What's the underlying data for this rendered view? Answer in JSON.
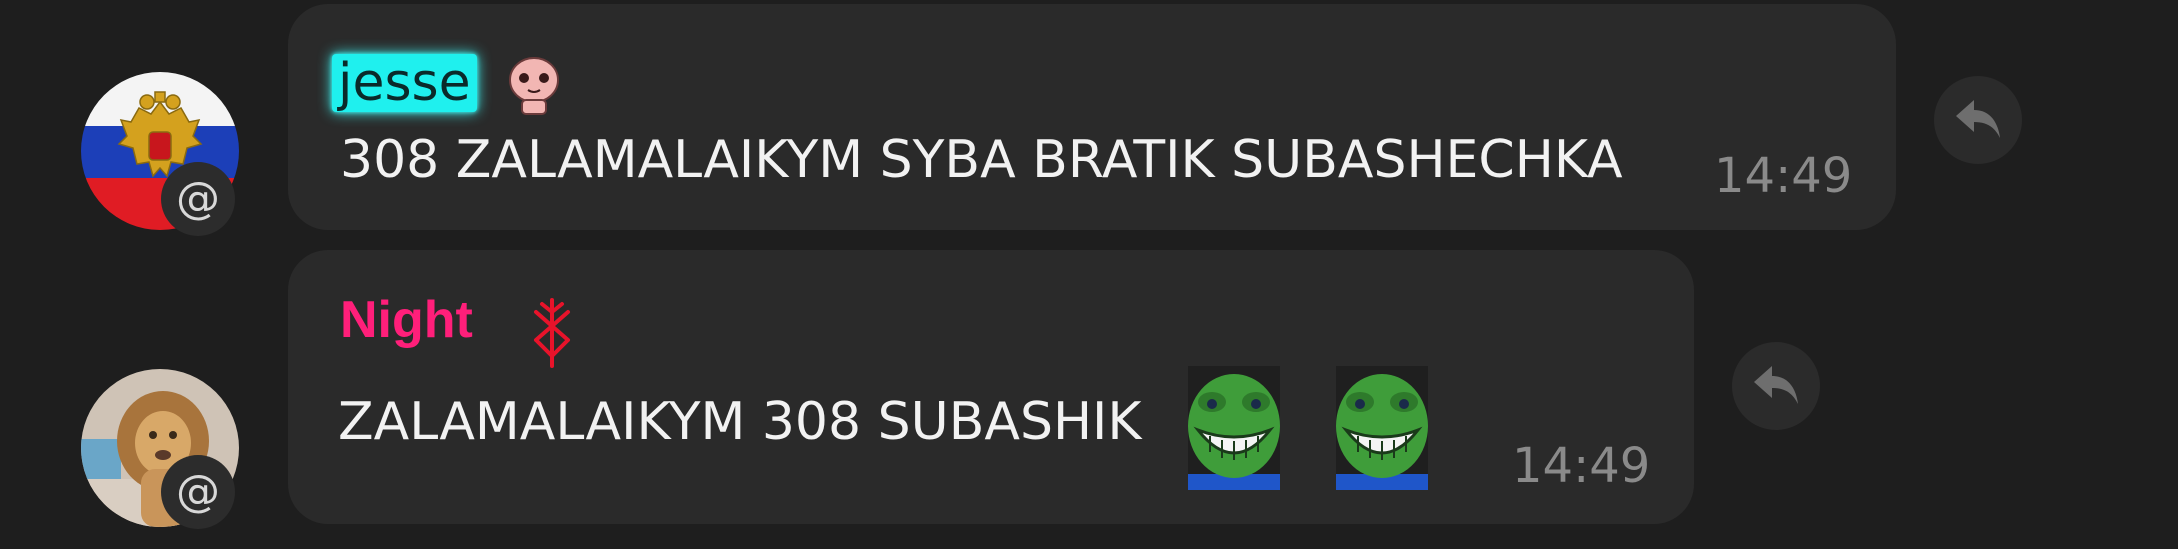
{
  "messages": [
    {
      "author": "jesse",
      "author_badge_icon": "pink-baby-head-icon",
      "text": "308 ZALAMALAIKYM SYBA BRATIK SUBASHECHKA",
      "time": "14:49",
      "avatar_icon": "russian-flag-coat-of-arms-avatar",
      "mention_badge": "@",
      "author_color": "#1ff0ee"
    },
    {
      "author": "Night",
      "author_badge_icon": "brand-of-sacrifice-icon",
      "text": "ZALAMALAIKYM 308 SUBASHIK",
      "emojis": [
        "grinning-pepe-emoji",
        "grinning-pepe-emoji"
      ],
      "time": "14:49",
      "avatar_icon": "lion-avatar",
      "mention_badge": "@",
      "author_color": "#ff1f7a"
    }
  ],
  "colors": {
    "background": "#1e1e1e",
    "bubble": "#2a2a2a",
    "text": "#f2f2f2",
    "timestamp": "#8a8a8a"
  }
}
